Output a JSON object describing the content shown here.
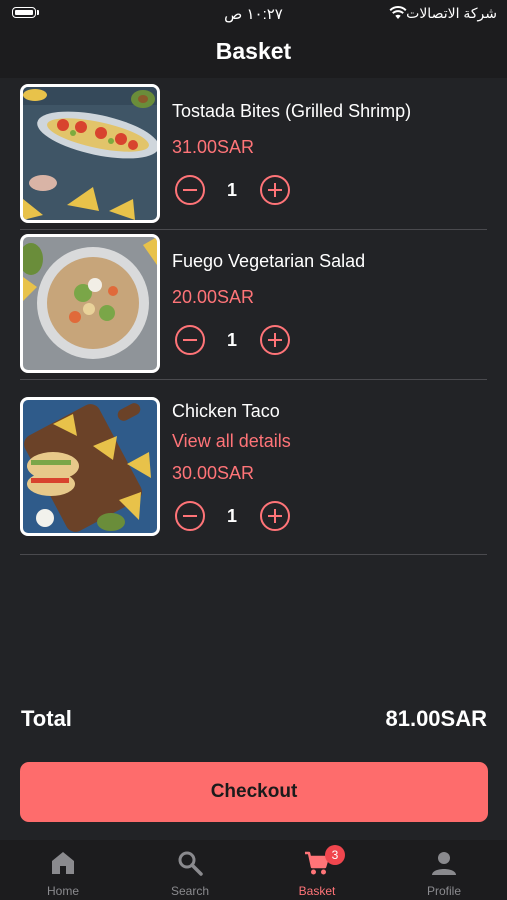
{
  "status_bar": {
    "carrier": "شركة الاتصالات",
    "time": "١٠:٢٧ ص"
  },
  "header": {
    "title": "Basket"
  },
  "items": [
    {
      "name": "Tostada Bites (Grilled Shrimp)",
      "price": "31.00SAR",
      "quantity": "1",
      "link": ""
    },
    {
      "name": "Fuego Vegetarian Salad",
      "price": "20.00SAR",
      "quantity": "1",
      "link": ""
    },
    {
      "name": "Chicken Taco",
      "link": "View all details",
      "price": "30.00SAR",
      "quantity": "1"
    }
  ],
  "total": {
    "label": "Total",
    "value": "81.00SAR"
  },
  "checkout": {
    "label": "Checkout"
  },
  "tabbar": {
    "tabs": [
      {
        "label": "Home",
        "icon": "home-icon"
      },
      {
        "label": "Search",
        "icon": "search-icon"
      },
      {
        "label": "Basket",
        "icon": "cart-icon",
        "badge": "3"
      },
      {
        "label": "Profile",
        "icon": "person-icon"
      }
    ],
    "active": "Basket"
  },
  "colors": {
    "accent": "#fe6c6c",
    "background": "#222326",
    "bar": "#1c1c1e",
    "badge": "#f0464e"
  }
}
